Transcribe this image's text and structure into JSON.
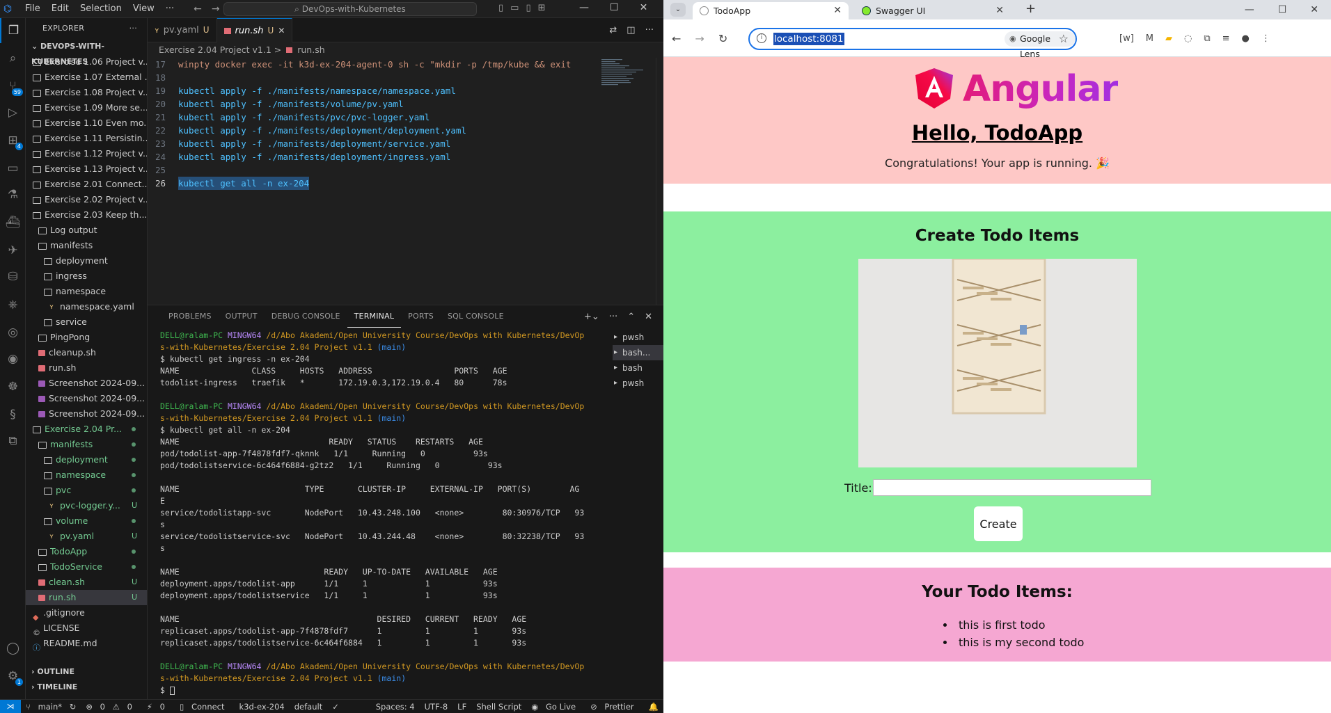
{
  "vscode": {
    "menu": [
      "File",
      "Edit",
      "Selection",
      "View",
      "···"
    ],
    "command_center": "DevOps-with-Kubernetes",
    "explorer_title": "EXPLORER",
    "explorer_more": "···",
    "root_folder": "DEVOPS-WITH-KUBERNETES",
    "tree": [
      {
        "label": "Exercise 1.06 Project v...",
        "indent": 0,
        "type": "folder"
      },
      {
        "label": "Exercise 1.07 External ...",
        "indent": 0,
        "type": "folder"
      },
      {
        "label": "Exercise 1.08 Project v...",
        "indent": 0,
        "type": "folder"
      },
      {
        "label": "Exercise 1.09 More se...",
        "indent": 0,
        "type": "folder"
      },
      {
        "label": "Exercise 1.10 Even mo...",
        "indent": 0,
        "type": "folder"
      },
      {
        "label": "Exercise 1.11 Persistin...",
        "indent": 0,
        "type": "folder"
      },
      {
        "label": "Exercise 1.12 Project v...",
        "indent": 0,
        "type": "folder"
      },
      {
        "label": "Exercise 1.13 Project v...",
        "indent": 0,
        "type": "folder"
      },
      {
        "label": "Exercise 2.01 Connect...",
        "indent": 0,
        "type": "folder"
      },
      {
        "label": "Exercise 2.02 Project v...",
        "indent": 0,
        "type": "folder"
      },
      {
        "label": "Exercise 2.03 Keep th...",
        "indent": 0,
        "type": "folder"
      },
      {
        "label": "Log output",
        "indent": 1,
        "type": "folder"
      },
      {
        "label": "manifests",
        "indent": 1,
        "type": "folder"
      },
      {
        "label": "deployment",
        "indent": 2,
        "type": "folder"
      },
      {
        "label": "ingress",
        "indent": 2,
        "type": "folder"
      },
      {
        "label": "namespace",
        "indent": 2,
        "type": "folder"
      },
      {
        "label": "namespace.yaml",
        "indent": 3,
        "type": "yaml"
      },
      {
        "label": "service",
        "indent": 2,
        "type": "folder"
      },
      {
        "label": "PingPong",
        "indent": 1,
        "type": "folder"
      },
      {
        "label": "cleanup.sh",
        "indent": 1,
        "type": "sh"
      },
      {
        "label": "run.sh",
        "indent": 1,
        "type": "sh"
      },
      {
        "label": "Screenshot 2024-09...",
        "indent": 1,
        "type": "img"
      },
      {
        "label": "Screenshot 2024-09...",
        "indent": 1,
        "type": "img"
      },
      {
        "label": "Screenshot 2024-09...",
        "indent": 1,
        "type": "img"
      },
      {
        "label": "Exercise 2.04 Pr...",
        "indent": 0,
        "type": "folder",
        "color": "green",
        "dot": true
      },
      {
        "label": "manifests",
        "indent": 1,
        "type": "folder",
        "color": "green",
        "dot": true
      },
      {
        "label": "deployment",
        "indent": 2,
        "type": "folder",
        "color": "green",
        "dot": true
      },
      {
        "label": "namespace",
        "indent": 2,
        "type": "folder",
        "color": "green",
        "dot": true
      },
      {
        "label": "pvc",
        "indent": 2,
        "type": "folder",
        "color": "green",
        "dot": true
      },
      {
        "label": "pvc-logger.y...",
        "indent": 3,
        "type": "yaml",
        "color": "green",
        "status": "U"
      },
      {
        "label": "volume",
        "indent": 2,
        "type": "folder",
        "color": "green",
        "dot": true
      },
      {
        "label": "pv.yaml",
        "indent": 3,
        "type": "yaml",
        "color": "green",
        "status": "U"
      },
      {
        "label": "TodoApp",
        "indent": 1,
        "type": "folder",
        "color": "green",
        "dot": true
      },
      {
        "label": "TodoService",
        "indent": 1,
        "type": "folder",
        "color": "green",
        "dot": true
      },
      {
        "label": "clean.sh",
        "indent": 1,
        "type": "sh",
        "color": "green",
        "status": "U"
      },
      {
        "label": "run.sh",
        "indent": 1,
        "type": "sh",
        "color": "green",
        "status": "U",
        "selected": true
      },
      {
        "label": ".gitignore",
        "indent": 0,
        "type": "git"
      },
      {
        "label": "LICENSE",
        "indent": 0,
        "type": "lic"
      },
      {
        "label": "README.md",
        "indent": 0,
        "type": "info"
      }
    ],
    "outline": "OUTLINE",
    "timeline": "TIMELINE",
    "badges": {
      "scm": "59",
      "extensions": "4",
      "settings": "1"
    },
    "tabs": [
      {
        "label": "pv.yaml",
        "status": "U",
        "active": false
      },
      {
        "label": "run.sh",
        "status": "U",
        "active": true
      }
    ],
    "breadcrumb": {
      "folder": "Exercise 2.04 Project v1.1",
      "sep": ">",
      "file": "run.sh"
    },
    "code_lines": [
      {
        "n": "17",
        "text": "winpty docker exec -it k3d-ex-204-agent-0 sh -c \"mkdir -p /tmp/kube && exit"
      },
      {
        "n": "18",
        "text": ""
      },
      {
        "n": "19",
        "text": "kubectl apply -f ./manifests/namespace/namespace.yaml"
      },
      {
        "n": "20",
        "text": "kubectl apply -f ./manifests/volume/pv.yaml"
      },
      {
        "n": "21",
        "text": "kubectl apply -f ./manifests/pvc/pvc-logger.yaml"
      },
      {
        "n": "22",
        "text": "kubectl apply -f ./manifests/deployment/deployment.yaml"
      },
      {
        "n": "23",
        "text": "kubectl apply -f ./manifests/deployment/service.yaml"
      },
      {
        "n": "24",
        "text": "kubectl apply -f ./manifests/deployment/ingress.yaml"
      },
      {
        "n": "25",
        "text": ""
      },
      {
        "n": "26",
        "text": "kubectl get all -n ex-204"
      }
    ],
    "panel_tabs": [
      "PROBLEMS",
      "OUTPUT",
      "DEBUG CONSOLE",
      "TERMINAL",
      "PORTS",
      "SQL CONSOLE"
    ],
    "panel_active": "TERMINAL",
    "terminal": {
      "prompt_user": "DELL@ralam-PC",
      "prompt_host": "MINGW64",
      "prompt_path1": "/d/Abo Akademi/Open University Course/DevOps with Kubernetes/DevOp",
      "prompt_path2": "s-with-Kubernetes/Exercise 2.04 Project v1.1",
      "prompt_branch": "(main)",
      "cmd1": "$ kubectl get ingress -n ex-204",
      "ingress_header": "NAME               CLASS     HOSTS   ADDRESS                 PORTS   AGE",
      "ingress_row": "todolist-ingress   traefik   *       172.19.0.3,172.19.0.4   80      78s",
      "cmd2": "$ kubectl get all -n ex-204",
      "pods_header": "NAME                               READY   STATUS    RESTARTS   AGE",
      "pod1": "pod/todolist-app-7f4878fdf7-qknnk   1/1     Running   0          93s",
      "pod2": "pod/todolistservice-6c464f6884-g2tz2   1/1     Running   0          93s",
      "svc_header": "NAME                          TYPE       CLUSTER-IP     EXTERNAL-IP   PORT(S)        AG",
      "svc_header_wrap": "E",
      "svc1": "service/todolistapp-svc       NodePort   10.43.248.100   <none>        80:30976/TCP   93",
      "svc1_wrap": "s",
      "svc2": "service/todolistservice-svc   NodePort   10.43.244.48    <none>        80:32238/TCP   93",
      "svc2_wrap": "s",
      "deploy_header": "NAME                              READY   UP-TO-DATE   AVAILABLE   AGE",
      "deploy1": "deployment.apps/todolist-app      1/1     1            1           93s",
      "deploy2": "deployment.apps/todolistservice   1/1     1            1           93s",
      "rs_header": "NAME                                         DESIRED   CURRENT   READY   AGE",
      "rs1": "replicaset.apps/todolist-app-7f4878fdf7      1         1         1       93s",
      "rs2": "replicaset.apps/todolistservice-6c464f6884   1         1         1       93s",
      "final_prompt": "$ "
    },
    "terminal_list": [
      "pwsh",
      "bash...",
      "bash",
      "pwsh"
    ],
    "statusbar": {
      "branch": "main*",
      "errors": "0",
      "warnings": "0",
      "ports": "0",
      "connect": "Connect",
      "context": "k3d-ex-204",
      "namespace": "default",
      "spaces": "Spaces: 4",
      "encoding": "UTF-8",
      "eol": "LF",
      "language": "Shell Script",
      "golive": "Go Live",
      "prettier": "Prettier"
    }
  },
  "chrome": {
    "tabs": [
      {
        "title": "TodoApp",
        "active": true
      },
      {
        "title": "Swagger UI",
        "active": false
      }
    ],
    "url": "localhost:8081",
    "lens_label": "Google Lens",
    "page": {
      "logo_text": "Angular",
      "hello": "Hello, TodoApp",
      "congrats": "Congratulations! Your app is running. 🎉",
      "create_title": "Create Todo Items",
      "title_label": "Title:",
      "title_value": "",
      "create_button": "Create",
      "list_title": "Your Todo Items:",
      "todos": [
        "this is first todo",
        "this is my second todo"
      ]
    }
  }
}
